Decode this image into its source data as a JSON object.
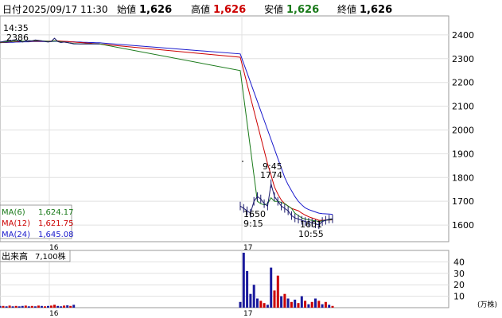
{
  "header": {
    "period_label": "日付",
    "datetime": "2025/09/17 11:30",
    "open_label": "始値",
    "open_value": "1,626",
    "high_label": "高値",
    "high_value": "1,626",
    "low_label": "安値",
    "low_value": "1,626",
    "close_label": "終値",
    "close_value": "1,626"
  },
  "ma_legend": [
    {
      "label": "MA(6)",
      "value": "1,624.17",
      "color": "#1a7a1a"
    },
    {
      "label": "MA(12)",
      "value": "1,621.75",
      "color": "#cc0000"
    },
    {
      "label": "MA(24)",
      "value": "1,645.08",
      "color": "#1a1acc"
    }
  ],
  "annotations": {
    "high_time": "14:35",
    "high_price": "2386",
    "mid_time": "9:45",
    "mid_price": "1774",
    "low1_price": "1650",
    "low1_time": "9:15",
    "low2_price": "1601",
    "low2_time": "10:55"
  },
  "volume": {
    "label": "出来高",
    "value": "7,100株",
    "unit": "(万株)"
  },
  "colors": {
    "up": "#cc0000",
    "down": "#1a1a9c",
    "ma6": "#1a7a1a",
    "ma12": "#cc0000",
    "ma24": "#1a1acc"
  },
  "chart_data": {
    "type": "line",
    "price_axis": {
      "ylim": [
        1530,
        2480
      ],
      "ticks": [
        1600,
        1700,
        1800,
        1900,
        2000,
        2100,
        2200,
        2300,
        2400
      ]
    },
    "volume_axis": {
      "ylim": [
        0,
        50
      ],
      "ticks": [
        10,
        20,
        30,
        40
      ]
    },
    "x_ticks": [
      "16",
      "17"
    ],
    "price": [
      2370,
      2372,
      2375,
      2373,
      2378,
      2380,
      2374,
      2370,
      2373,
      2376,
      2375,
      2379,
      2377,
      2375,
      2372,
      2370,
      2373,
      2386,
      2372,
      2368,
      2370,
      2368,
      2365,
      2362,
      2362,
      2362,
      2362,
      2362,
      2362,
      2362,
      2362,
      2362,
      1680,
      1670,
      1660,
      1650,
      1700,
      1720,
      1710,
      1690,
      1680,
      1774,
      1720,
      1700,
      1680,
      1670,
      1660,
      1640,
      1630,
      1625,
      1620,
      1615,
      1612,
      1610,
      1605,
      1601,
      1615,
      1620,
      1625,
      1626
    ],
    "ma6": [
      2369,
      2370,
      2371,
      2372,
      2373,
      2374,
      2375,
      2374,
      2373,
      2374,
      2375,
      2376,
      2376,
      2375,
      2374,
      2373,
      2372,
      2375,
      2373,
      2371,
      2370,
      2368,
      2366,
      2364,
      2363,
      2362,
      2362,
      2362,
      2362,
      2362,
      2362,
      2362,
      2250,
      2140,
      2030,
      1920,
      1810,
      1700,
      1690,
      1685,
      1690,
      1715,
      1700,
      1700,
      1695,
      1690,
      1680,
      1670,
      1650,
      1640,
      1630,
      1625,
      1622,
      1620,
      1618,
      1615,
      1618,
      1620,
      1622,
      1624
    ],
    "ma12": [
      2368,
      2369,
      2370,
      2371,
      2372,
      2372,
      2373,
      2373,
      2373,
      2373,
      2374,
      2374,
      2374,
      2374,
      2374,
      2374,
      2374,
      2375,
      2375,
      2374,
      2373,
      2372,
      2371,
      2370,
      2369,
      2368,
      2367,
      2366,
      2365,
      2364,
      2363,
      2362,
      2306,
      2250,
      2193,
      2137,
      2081,
      2025,
      1969,
      1913,
      1857,
      1810,
      1760,
      1730,
      1705,
      1690,
      1680,
      1670,
      1665,
      1660,
      1650,
      1642,
      1635,
      1630,
      1625,
      1620,
      1620,
      1621,
      1621,
      1622
    ],
    "ma24": [
      2367,
      2368,
      2368,
      2369,
      2369,
      2370,
      2370,
      2371,
      2371,
      2371,
      2372,
      2372,
      2372,
      2372,
      2372,
      2372,
      2372,
      2373,
      2373,
      2373,
      2372,
      2372,
      2371,
      2371,
      2370,
      2370,
      2369,
      2369,
      2368,
      2368,
      2367,
      2367,
      2320,
      2280,
      2240,
      2200,
      2160,
      2120,
      2080,
      2040,
      2000,
      1960,
      1920,
      1880,
      1840,
      1800,
      1770,
      1745,
      1720,
      1700,
      1685,
      1672,
      1665,
      1660,
      1655,
      1650,
      1648,
      1647,
      1646,
      1645
    ],
    "volume": [
      {
        "v": 1.5,
        "up": false
      },
      {
        "v": 1.5,
        "up": true
      },
      {
        "v": 1.2,
        "up": false
      },
      {
        "v": 1.8,
        "up": true
      },
      {
        "v": 1.2,
        "up": false
      },
      {
        "v": 1.5,
        "up": true
      },
      {
        "v": 1.2,
        "up": false
      },
      {
        "v": 1.5,
        "up": false
      },
      {
        "v": 1.8,
        "up": true
      },
      {
        "v": 1.2,
        "up": false
      },
      {
        "v": 1.5,
        "up": true
      },
      {
        "v": 1.2,
        "up": false
      },
      {
        "v": 1.8,
        "up": true
      },
      {
        "v": 1.5,
        "up": false
      },
      {
        "v": 1.2,
        "up": true
      },
      {
        "v": 1.5,
        "up": false
      },
      {
        "v": 1.8,
        "up": true
      },
      {
        "v": 2.5,
        "up": true
      },
      {
        "v": 1.5,
        "up": false
      },
      {
        "v": 1.2,
        "up": false
      },
      {
        "v": 1.8,
        "up": true
      },
      {
        "v": 2.0,
        "up": false
      },
      {
        "v": 1.5,
        "up": true
      },
      {
        "v": 2.5,
        "up": false
      },
      {
        "v": 0,
        "up": true
      },
      {
        "v": 0,
        "up": true
      },
      {
        "v": 0,
        "up": true
      },
      {
        "v": 0,
        "up": true
      },
      {
        "v": 0,
        "up": true
      },
      {
        "v": 0,
        "up": true
      },
      {
        "v": 0,
        "up": true
      },
      {
        "v": 0,
        "up": true
      },
      {
        "v": 5,
        "up": false
      },
      {
        "v": 48,
        "up": false
      },
      {
        "v": 32,
        "up": false
      },
      {
        "v": 12,
        "up": false
      },
      {
        "v": 20,
        "up": false
      },
      {
        "v": 8,
        "up": false
      },
      {
        "v": 6,
        "up": true
      },
      {
        "v": 4,
        "up": true
      },
      {
        "v": 2.5,
        "up": false
      },
      {
        "v": 35,
        "up": false
      },
      {
        "v": 15,
        "up": true
      },
      {
        "v": 28,
        "up": true
      },
      {
        "v": 10,
        "up": false
      },
      {
        "v": 12,
        "up": true
      },
      {
        "v": 8,
        "up": false
      },
      {
        "v": 5,
        "up": true
      },
      {
        "v": 7,
        "up": false
      },
      {
        "v": 4,
        "up": true
      },
      {
        "v": 10,
        "up": false
      },
      {
        "v": 6,
        "up": true
      },
      {
        "v": 3,
        "up": false
      },
      {
        "v": 5,
        "up": true
      },
      {
        "v": 8,
        "up": false
      },
      {
        "v": 6,
        "up": true
      },
      {
        "v": 3,
        "up": false
      },
      {
        "v": 5,
        "up": true
      },
      {
        "v": 2.5,
        "up": false
      },
      {
        "v": 1.5,
        "up": true
      }
    ]
  }
}
